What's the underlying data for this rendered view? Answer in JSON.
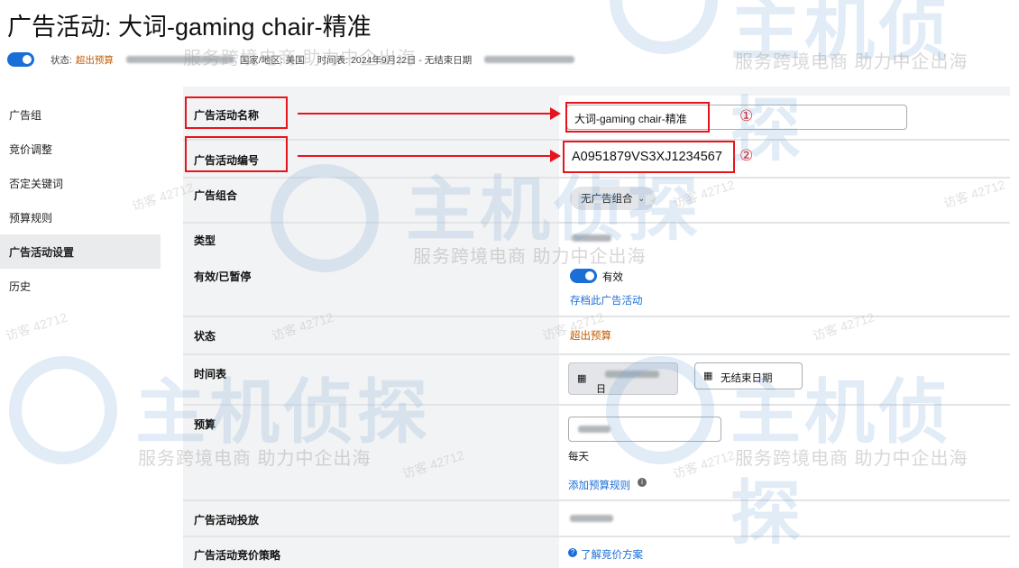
{
  "page": {
    "title": "广告活动: 大词-gaming chair-精准",
    "status_label": "状态:",
    "status_value": "超出预算",
    "region": "国家/地区: 美国",
    "schedule": "时间表: 2024年9月22日 - 无结束日期"
  },
  "sidebar": {
    "items": [
      {
        "label": "广告组"
      },
      {
        "label": "竞价调整"
      },
      {
        "label": "否定关键词"
      },
      {
        "label": "预算规则"
      },
      {
        "label": "广告活动设置"
      },
      {
        "label": "历史"
      }
    ]
  },
  "settings": {
    "name_label": "广告活动名称",
    "name_value": "大词-gaming chair-精准",
    "id_label": "广告活动编号",
    "id_value": "A0951879VS3XJ1234567",
    "portfolio_label": "广告组合",
    "portfolio_value": "无广告组合",
    "type_label": "类型",
    "active_label": "有效/已暂停",
    "active_value": "有效",
    "archive_link": "存档此广告活动",
    "state_label": "状态",
    "state_value": "超出预算",
    "schedule_label": "时间表",
    "start_date_suffix": "日",
    "end_date_button": "无结束日期",
    "budget_label": "预算",
    "budget_period": "每天",
    "add_budget_rule": "添加预算规则",
    "delivery_label": "广告活动投放",
    "bidding_label": "广告活动竞价策略",
    "bidding_link": "了解竞价方案"
  },
  "annotations": {
    "marker1": "①",
    "marker2": "②"
  },
  "watermark": {
    "brand": "主机侦探",
    "slogan": "服务跨境电商 助力中企出海",
    "visitor": "访客 42712"
  },
  "colors": {
    "accent_blue": "#1a6ed8",
    "warning_orange": "#c15a00",
    "annotation_red": "#e8141c",
    "panel_gray": "#f2f3f4"
  }
}
